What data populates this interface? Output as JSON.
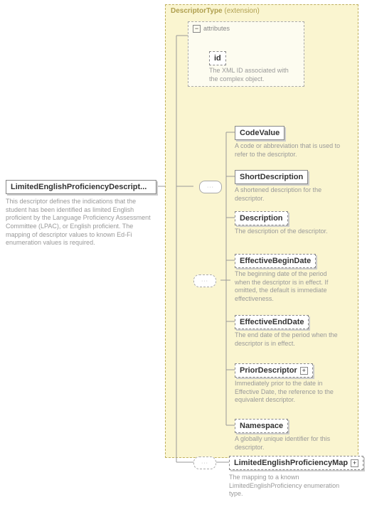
{
  "root": {
    "label": "LimitedEnglishProficiencyDescript...",
    "desc": "This descriptor defines the indications that the student has been identified as limited English proficient by the Language Proficiency Assessment Committee (LPAC), or English proficient. The mapping of descriptor values to known Ed-Fi enumeration values is required."
  },
  "ext": {
    "label": "DescriptorType",
    "note": "(extension)"
  },
  "attr": {
    "group": "attributes",
    "id": {
      "label": "id",
      "desc": "The XML ID associated with the complex object."
    }
  },
  "children": [
    {
      "label": "CodeValue",
      "desc": "A code or abbreviation that is used to refer to the descriptor.",
      "req": true
    },
    {
      "label": "ShortDescription",
      "desc": "A shortened description for the descriptor.",
      "req": true
    },
    {
      "label": "Description",
      "desc": "The description of the descriptor.",
      "req": false
    },
    {
      "label": "EffectiveBeginDate",
      "desc": "The beginning date of the period when the descriptor is in effect. If omitted, the default is immediate effectiveness.",
      "req": false
    },
    {
      "label": "EffectiveEndDate",
      "desc": "The end date of the period when the descriptor is in effect.",
      "req": false
    },
    {
      "label": "PriorDescriptor",
      "desc": "Immediately prior to the date in Effective Date, the reference to the equivalent descriptor.",
      "req": false,
      "expand": true
    },
    {
      "label": "Namespace",
      "desc": "A globally unique identifier for this descriptor.",
      "req": false
    }
  ],
  "outer": {
    "label": "LimitedEnglishProficiencyMap",
    "desc": "The mapping to a known LimitedEnglishProficiency enumeration type."
  }
}
